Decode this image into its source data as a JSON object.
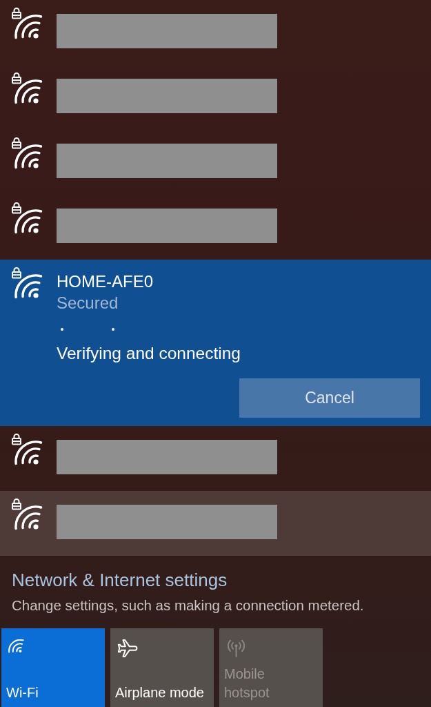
{
  "networks": [
    {
      "kind": "redacted",
      "secured": true,
      "selected": false,
      "highlighted": false
    },
    {
      "kind": "redacted",
      "secured": true,
      "selected": false,
      "highlighted": false
    },
    {
      "kind": "redacted",
      "secured": true,
      "selected": false,
      "highlighted": false
    },
    {
      "kind": "redacted",
      "secured": true,
      "selected": false,
      "highlighted": false
    },
    {
      "kind": "connecting",
      "secured": true,
      "selected": true,
      "highlighted": false,
      "name": "HOME-AFE0",
      "security": "Secured",
      "status": "Verifying and connecting",
      "action": "Cancel"
    },
    {
      "kind": "redacted",
      "secured": true,
      "selected": false,
      "highlighted": false
    },
    {
      "kind": "redacted",
      "secured": true,
      "selected": false,
      "highlighted": true
    }
  ],
  "settings": {
    "title": "Network & Internet settings",
    "description": "Change settings, such as making a connection metered."
  },
  "quick_actions": [
    {
      "kind": "wifi",
      "label": "Wi-Fi",
      "on": true,
      "disabled": false
    },
    {
      "kind": "airplane",
      "label": "Airplane mode",
      "on": false,
      "disabled": false
    },
    {
      "kind": "hotspot",
      "label": "Mobile\nhotspot",
      "on": false,
      "disabled": true
    }
  ]
}
